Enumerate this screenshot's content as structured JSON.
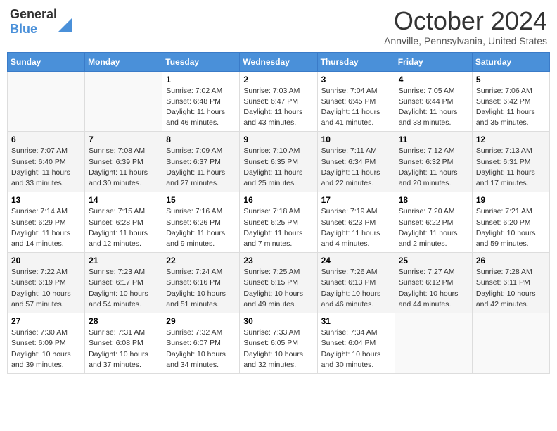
{
  "header": {
    "logo_general": "General",
    "logo_blue": "Blue",
    "month_title": "October 2024",
    "location": "Annville, Pennsylvania, United States"
  },
  "weekdays": [
    "Sunday",
    "Monday",
    "Tuesday",
    "Wednesday",
    "Thursday",
    "Friday",
    "Saturday"
  ],
  "weeks": [
    [
      {
        "day": "",
        "sunrise": "",
        "sunset": "",
        "daylight": ""
      },
      {
        "day": "",
        "sunrise": "",
        "sunset": "",
        "daylight": ""
      },
      {
        "day": "1",
        "sunrise": "Sunrise: 7:02 AM",
        "sunset": "Sunset: 6:48 PM",
        "daylight": "Daylight: 11 hours and 46 minutes."
      },
      {
        "day": "2",
        "sunrise": "Sunrise: 7:03 AM",
        "sunset": "Sunset: 6:47 PM",
        "daylight": "Daylight: 11 hours and 43 minutes."
      },
      {
        "day": "3",
        "sunrise": "Sunrise: 7:04 AM",
        "sunset": "Sunset: 6:45 PM",
        "daylight": "Daylight: 11 hours and 41 minutes."
      },
      {
        "day": "4",
        "sunrise": "Sunrise: 7:05 AM",
        "sunset": "Sunset: 6:44 PM",
        "daylight": "Daylight: 11 hours and 38 minutes."
      },
      {
        "day": "5",
        "sunrise": "Sunrise: 7:06 AM",
        "sunset": "Sunset: 6:42 PM",
        "daylight": "Daylight: 11 hours and 35 minutes."
      }
    ],
    [
      {
        "day": "6",
        "sunrise": "Sunrise: 7:07 AM",
        "sunset": "Sunset: 6:40 PM",
        "daylight": "Daylight: 11 hours and 33 minutes."
      },
      {
        "day": "7",
        "sunrise": "Sunrise: 7:08 AM",
        "sunset": "Sunset: 6:39 PM",
        "daylight": "Daylight: 11 hours and 30 minutes."
      },
      {
        "day": "8",
        "sunrise": "Sunrise: 7:09 AM",
        "sunset": "Sunset: 6:37 PM",
        "daylight": "Daylight: 11 hours and 27 minutes."
      },
      {
        "day": "9",
        "sunrise": "Sunrise: 7:10 AM",
        "sunset": "Sunset: 6:35 PM",
        "daylight": "Daylight: 11 hours and 25 minutes."
      },
      {
        "day": "10",
        "sunrise": "Sunrise: 7:11 AM",
        "sunset": "Sunset: 6:34 PM",
        "daylight": "Daylight: 11 hours and 22 minutes."
      },
      {
        "day": "11",
        "sunrise": "Sunrise: 7:12 AM",
        "sunset": "Sunset: 6:32 PM",
        "daylight": "Daylight: 11 hours and 20 minutes."
      },
      {
        "day": "12",
        "sunrise": "Sunrise: 7:13 AM",
        "sunset": "Sunset: 6:31 PM",
        "daylight": "Daylight: 11 hours and 17 minutes."
      }
    ],
    [
      {
        "day": "13",
        "sunrise": "Sunrise: 7:14 AM",
        "sunset": "Sunset: 6:29 PM",
        "daylight": "Daylight: 11 hours and 14 minutes."
      },
      {
        "day": "14",
        "sunrise": "Sunrise: 7:15 AM",
        "sunset": "Sunset: 6:28 PM",
        "daylight": "Daylight: 11 hours and 12 minutes."
      },
      {
        "day": "15",
        "sunrise": "Sunrise: 7:16 AM",
        "sunset": "Sunset: 6:26 PM",
        "daylight": "Daylight: 11 hours and 9 minutes."
      },
      {
        "day": "16",
        "sunrise": "Sunrise: 7:18 AM",
        "sunset": "Sunset: 6:25 PM",
        "daylight": "Daylight: 11 hours and 7 minutes."
      },
      {
        "day": "17",
        "sunrise": "Sunrise: 7:19 AM",
        "sunset": "Sunset: 6:23 PM",
        "daylight": "Daylight: 11 hours and 4 minutes."
      },
      {
        "day": "18",
        "sunrise": "Sunrise: 7:20 AM",
        "sunset": "Sunset: 6:22 PM",
        "daylight": "Daylight: 11 hours and 2 minutes."
      },
      {
        "day": "19",
        "sunrise": "Sunrise: 7:21 AM",
        "sunset": "Sunset: 6:20 PM",
        "daylight": "Daylight: 10 hours and 59 minutes."
      }
    ],
    [
      {
        "day": "20",
        "sunrise": "Sunrise: 7:22 AM",
        "sunset": "Sunset: 6:19 PM",
        "daylight": "Daylight: 10 hours and 57 minutes."
      },
      {
        "day": "21",
        "sunrise": "Sunrise: 7:23 AM",
        "sunset": "Sunset: 6:17 PM",
        "daylight": "Daylight: 10 hours and 54 minutes."
      },
      {
        "day": "22",
        "sunrise": "Sunrise: 7:24 AM",
        "sunset": "Sunset: 6:16 PM",
        "daylight": "Daylight: 10 hours and 51 minutes."
      },
      {
        "day": "23",
        "sunrise": "Sunrise: 7:25 AM",
        "sunset": "Sunset: 6:15 PM",
        "daylight": "Daylight: 10 hours and 49 minutes."
      },
      {
        "day": "24",
        "sunrise": "Sunrise: 7:26 AM",
        "sunset": "Sunset: 6:13 PM",
        "daylight": "Daylight: 10 hours and 46 minutes."
      },
      {
        "day": "25",
        "sunrise": "Sunrise: 7:27 AM",
        "sunset": "Sunset: 6:12 PM",
        "daylight": "Daylight: 10 hours and 44 minutes."
      },
      {
        "day": "26",
        "sunrise": "Sunrise: 7:28 AM",
        "sunset": "Sunset: 6:11 PM",
        "daylight": "Daylight: 10 hours and 42 minutes."
      }
    ],
    [
      {
        "day": "27",
        "sunrise": "Sunrise: 7:30 AM",
        "sunset": "Sunset: 6:09 PM",
        "daylight": "Daylight: 10 hours and 39 minutes."
      },
      {
        "day": "28",
        "sunrise": "Sunrise: 7:31 AM",
        "sunset": "Sunset: 6:08 PM",
        "daylight": "Daylight: 10 hours and 37 minutes."
      },
      {
        "day": "29",
        "sunrise": "Sunrise: 7:32 AM",
        "sunset": "Sunset: 6:07 PM",
        "daylight": "Daylight: 10 hours and 34 minutes."
      },
      {
        "day": "30",
        "sunrise": "Sunrise: 7:33 AM",
        "sunset": "Sunset: 6:05 PM",
        "daylight": "Daylight: 10 hours and 32 minutes."
      },
      {
        "day": "31",
        "sunrise": "Sunrise: 7:34 AM",
        "sunset": "Sunset: 6:04 PM",
        "daylight": "Daylight: 10 hours and 30 minutes."
      },
      {
        "day": "",
        "sunrise": "",
        "sunset": "",
        "daylight": ""
      },
      {
        "day": "",
        "sunrise": "",
        "sunset": "",
        "daylight": ""
      }
    ]
  ]
}
